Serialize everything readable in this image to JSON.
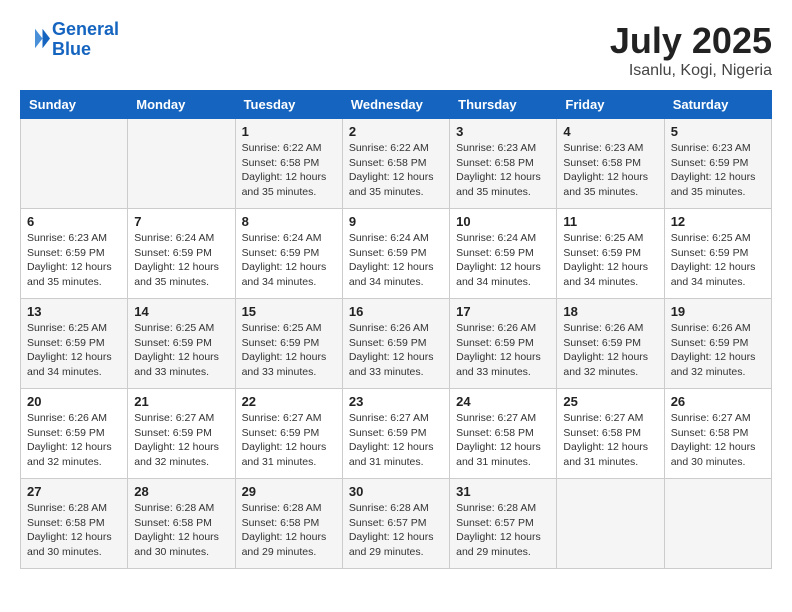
{
  "header": {
    "logo_line1": "General",
    "logo_line2": "Blue",
    "month_year": "July 2025",
    "location": "Isanlu, Kogi, Nigeria"
  },
  "days_of_week": [
    "Sunday",
    "Monday",
    "Tuesday",
    "Wednesday",
    "Thursday",
    "Friday",
    "Saturday"
  ],
  "weeks": [
    [
      {
        "day": "",
        "info": ""
      },
      {
        "day": "",
        "info": ""
      },
      {
        "day": "1",
        "info": "Sunrise: 6:22 AM\nSunset: 6:58 PM\nDaylight: 12 hours and 35 minutes."
      },
      {
        "day": "2",
        "info": "Sunrise: 6:22 AM\nSunset: 6:58 PM\nDaylight: 12 hours and 35 minutes."
      },
      {
        "day": "3",
        "info": "Sunrise: 6:23 AM\nSunset: 6:58 PM\nDaylight: 12 hours and 35 minutes."
      },
      {
        "day": "4",
        "info": "Sunrise: 6:23 AM\nSunset: 6:58 PM\nDaylight: 12 hours and 35 minutes."
      },
      {
        "day": "5",
        "info": "Sunrise: 6:23 AM\nSunset: 6:59 PM\nDaylight: 12 hours and 35 minutes."
      }
    ],
    [
      {
        "day": "6",
        "info": "Sunrise: 6:23 AM\nSunset: 6:59 PM\nDaylight: 12 hours and 35 minutes."
      },
      {
        "day": "7",
        "info": "Sunrise: 6:24 AM\nSunset: 6:59 PM\nDaylight: 12 hours and 35 minutes."
      },
      {
        "day": "8",
        "info": "Sunrise: 6:24 AM\nSunset: 6:59 PM\nDaylight: 12 hours and 34 minutes."
      },
      {
        "day": "9",
        "info": "Sunrise: 6:24 AM\nSunset: 6:59 PM\nDaylight: 12 hours and 34 minutes."
      },
      {
        "day": "10",
        "info": "Sunrise: 6:24 AM\nSunset: 6:59 PM\nDaylight: 12 hours and 34 minutes."
      },
      {
        "day": "11",
        "info": "Sunrise: 6:25 AM\nSunset: 6:59 PM\nDaylight: 12 hours and 34 minutes."
      },
      {
        "day": "12",
        "info": "Sunrise: 6:25 AM\nSunset: 6:59 PM\nDaylight: 12 hours and 34 minutes."
      }
    ],
    [
      {
        "day": "13",
        "info": "Sunrise: 6:25 AM\nSunset: 6:59 PM\nDaylight: 12 hours and 34 minutes."
      },
      {
        "day": "14",
        "info": "Sunrise: 6:25 AM\nSunset: 6:59 PM\nDaylight: 12 hours and 33 minutes."
      },
      {
        "day": "15",
        "info": "Sunrise: 6:25 AM\nSunset: 6:59 PM\nDaylight: 12 hours and 33 minutes."
      },
      {
        "day": "16",
        "info": "Sunrise: 6:26 AM\nSunset: 6:59 PM\nDaylight: 12 hours and 33 minutes."
      },
      {
        "day": "17",
        "info": "Sunrise: 6:26 AM\nSunset: 6:59 PM\nDaylight: 12 hours and 33 minutes."
      },
      {
        "day": "18",
        "info": "Sunrise: 6:26 AM\nSunset: 6:59 PM\nDaylight: 12 hours and 32 minutes."
      },
      {
        "day": "19",
        "info": "Sunrise: 6:26 AM\nSunset: 6:59 PM\nDaylight: 12 hours and 32 minutes."
      }
    ],
    [
      {
        "day": "20",
        "info": "Sunrise: 6:26 AM\nSunset: 6:59 PM\nDaylight: 12 hours and 32 minutes."
      },
      {
        "day": "21",
        "info": "Sunrise: 6:27 AM\nSunset: 6:59 PM\nDaylight: 12 hours and 32 minutes."
      },
      {
        "day": "22",
        "info": "Sunrise: 6:27 AM\nSunset: 6:59 PM\nDaylight: 12 hours and 31 minutes."
      },
      {
        "day": "23",
        "info": "Sunrise: 6:27 AM\nSunset: 6:59 PM\nDaylight: 12 hours and 31 minutes."
      },
      {
        "day": "24",
        "info": "Sunrise: 6:27 AM\nSunset: 6:58 PM\nDaylight: 12 hours and 31 minutes."
      },
      {
        "day": "25",
        "info": "Sunrise: 6:27 AM\nSunset: 6:58 PM\nDaylight: 12 hours and 31 minutes."
      },
      {
        "day": "26",
        "info": "Sunrise: 6:27 AM\nSunset: 6:58 PM\nDaylight: 12 hours and 30 minutes."
      }
    ],
    [
      {
        "day": "27",
        "info": "Sunrise: 6:28 AM\nSunset: 6:58 PM\nDaylight: 12 hours and 30 minutes."
      },
      {
        "day": "28",
        "info": "Sunrise: 6:28 AM\nSunset: 6:58 PM\nDaylight: 12 hours and 30 minutes."
      },
      {
        "day": "29",
        "info": "Sunrise: 6:28 AM\nSunset: 6:58 PM\nDaylight: 12 hours and 29 minutes."
      },
      {
        "day": "30",
        "info": "Sunrise: 6:28 AM\nSunset: 6:57 PM\nDaylight: 12 hours and 29 minutes."
      },
      {
        "day": "31",
        "info": "Sunrise: 6:28 AM\nSunset: 6:57 PM\nDaylight: 12 hours and 29 minutes."
      },
      {
        "day": "",
        "info": ""
      },
      {
        "day": "",
        "info": ""
      }
    ]
  ]
}
